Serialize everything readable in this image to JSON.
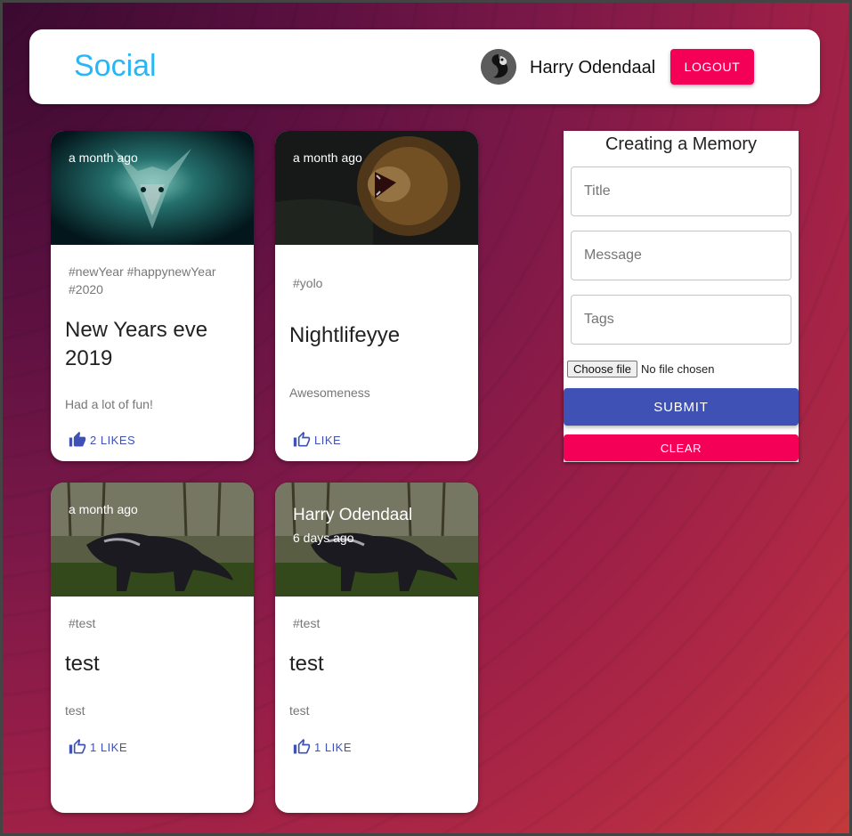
{
  "header": {
    "brand": "Social",
    "user_name": "Harry Odendaal",
    "logout_label": "LOGOUT"
  },
  "posts": [
    {
      "time": "a month ago",
      "tags": "#newYear #happynewYear #2020",
      "title": "New Years eve 2019",
      "message": "Had a lot of fun!",
      "likes": "2 LIKES",
      "image": "glowing-wolf-image"
    },
    {
      "time": "a month ago",
      "tags": "#yolo",
      "title": "Nightlifeyye",
      "message": "Awesomeness",
      "likes": "LIKE",
      "image": "roaring-lion-image"
    },
    {
      "time": "a month ago",
      "tags": "#test",
      "title": "test",
      "message": "test",
      "likes": "1 LIKE",
      "image": "dark-fox-image"
    },
    {
      "creator": "Harry Odendaal",
      "time": "6 days ago",
      "tags": "#test",
      "title": "test",
      "message": "test",
      "likes": "1 LIKE",
      "image": "dark-fox-image"
    }
  ],
  "form": {
    "heading": "Creating a Memory",
    "title_placeholder": "Title",
    "message_placeholder": "Message",
    "tags_placeholder": "Tags",
    "file_button": "Choose file",
    "file_status": "No file chosen",
    "submit_label": "SUBMIT",
    "clear_label": "CLEAR"
  },
  "colors": {
    "brand": "#29b6f6",
    "primary": "#3f51b5",
    "secondary": "#f50057"
  }
}
